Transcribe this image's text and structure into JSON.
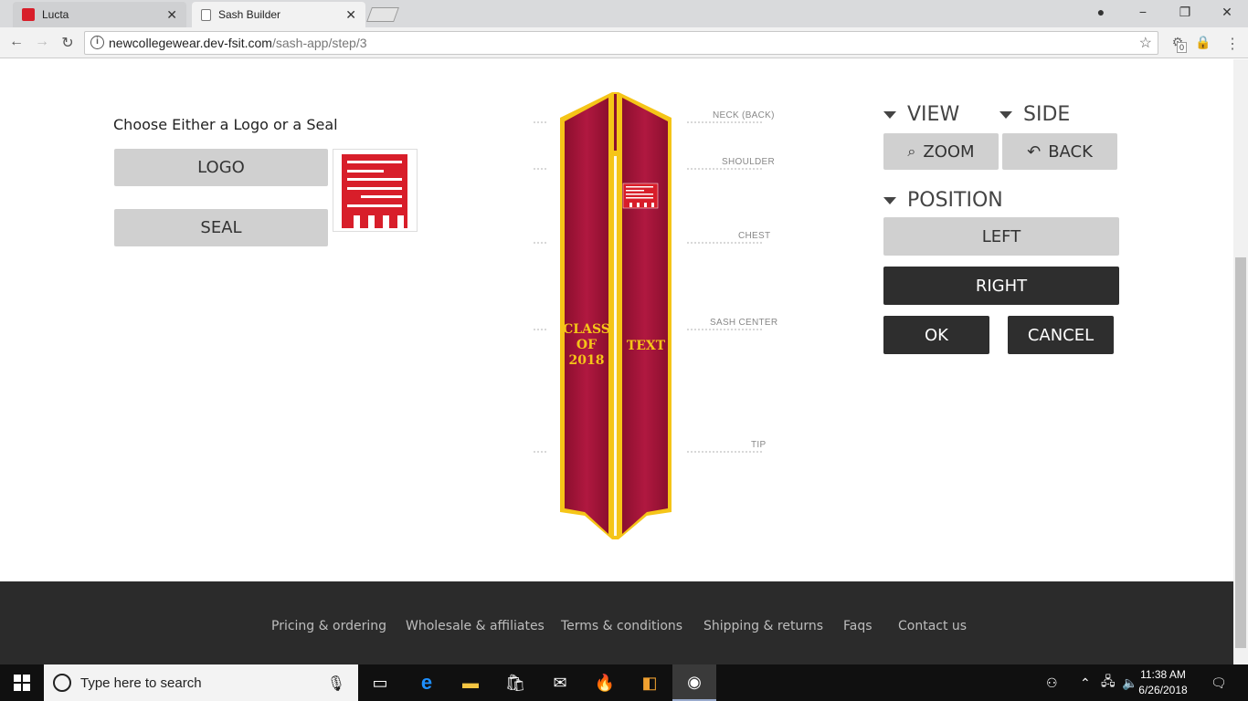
{
  "browser": {
    "tabs": [
      {
        "label": "Lucta"
      },
      {
        "label": "Sash Builder"
      }
    ],
    "url_host": "newcollegewear.dev-fsit.com",
    "url_path": "/sash-app/step/3",
    "extension_badge": "0"
  },
  "left_panel": {
    "heading": "Choose Either a Logo or a Seal",
    "logo_button": "LOGO",
    "seal_button": "SEAL"
  },
  "sash": {
    "left_text": [
      "CLASS",
      "OF",
      "2018"
    ],
    "right_text": "TEXT",
    "markers": [
      "NECK (BACK)",
      "SHOULDER",
      "CHEST",
      "SASH CENTER",
      "TIP"
    ],
    "colors": {
      "main": "#a8143a",
      "trim": "#f5c518",
      "seal": "#d81e2a"
    }
  },
  "controls": {
    "view_label": "VIEW",
    "side_label": "SIDE",
    "zoom_button": "ZOOM",
    "back_button": "BACK",
    "position_label": "POSITION",
    "left_button": "LEFT",
    "right_button": "RIGHT",
    "ok_button": "OK",
    "cancel_button": "CANCEL"
  },
  "footer": {
    "links": [
      "Pricing & ordering",
      "Wholesale & affiliates",
      "Terms & conditions",
      "Shipping & returns",
      "Faqs",
      "Contact us"
    ]
  },
  "taskbar": {
    "search_placeholder": "Type here to search",
    "time": "11:38 AM",
    "date": "6/26/2018"
  }
}
